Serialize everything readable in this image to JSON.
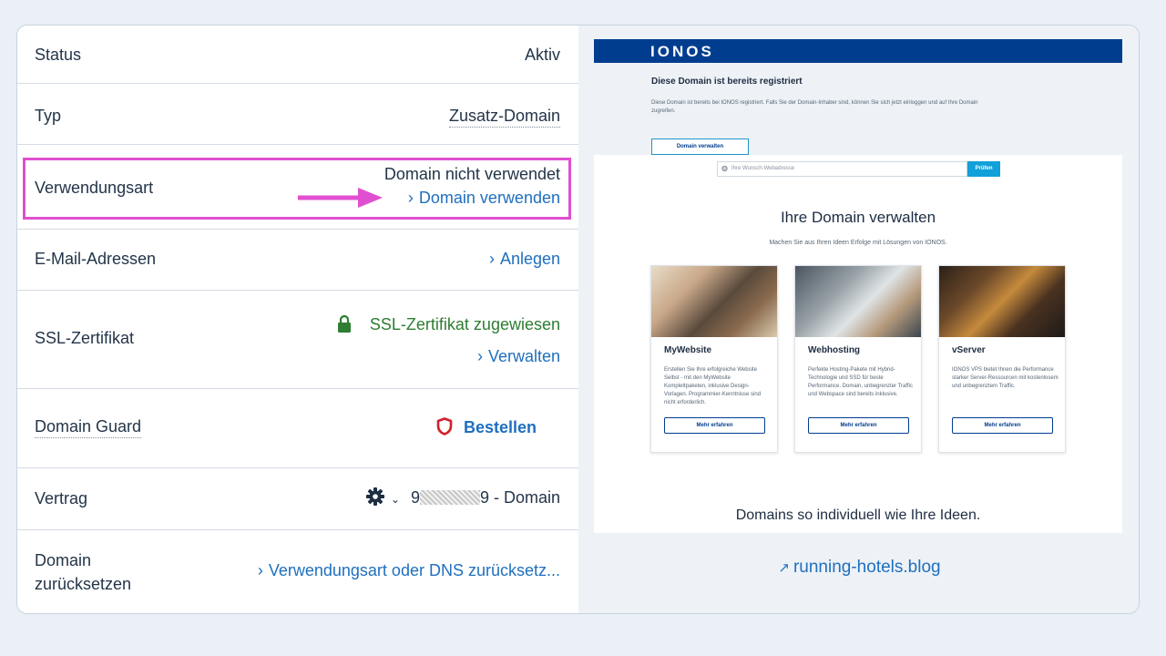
{
  "left": {
    "rows": [
      {
        "label": "Status",
        "value": "Aktiv"
      },
      {
        "label": "Typ",
        "value": "Zusatz-Domain"
      },
      {
        "label": "Verwendungsart",
        "value": "Domain nicht verwendet",
        "link": "Domain verwenden"
      },
      {
        "label": "E-Mail-Adressen",
        "link": "Anlegen"
      },
      {
        "label": "SSL-Zertifikat",
        "value": "SSL-Zertifikat zugewiesen",
        "link": "Verwalten"
      },
      {
        "label": "Domain Guard",
        "link": "Bestellen"
      },
      {
        "label": "Vertrag",
        "value_prefix": "9",
        "value_suffix": "9 - Domain"
      },
      {
        "label_line1": "Domain",
        "label_line2": "zurücksetzen",
        "link": "Verwendungsart oder DNS zurücksetz..."
      }
    ]
  },
  "preview": {
    "logo": "IONOS",
    "registered_title": "Diese Domain ist bereits registriert",
    "registered_text": "Diese Domain ist bereits bei IONOS registriert. Falls Sie der Domain-Inhaber sind, können Sie sich jetzt einloggen und auf Ihre Domain zugreifen.",
    "manage_button": "Domain verwalten",
    "search_placeholder": "Ihre Wunsch-Webadresse",
    "search_button": "Prüfen",
    "heading": "Ihre Domain verwalten",
    "subheading": "Machen Sie aus Ihren Ideen Erfolge mit Lösungen von IONOS.",
    "cards": [
      {
        "title": "MyWebsite",
        "desc": "Erstellen Sie Ihre erfolgreiche Website Selbst - mit den MyWebsite Komplettpaketen, inklusive Design-Vorlagen. Programmier-Kenntnisse sind nicht erforderlich.",
        "button": "Mehr erfahren"
      },
      {
        "title": "Webhosting",
        "desc": "Perfekte Hosting-Pakete mit Hybrid-Technologie und SSD für beste Performance. Domain, unbegrenzter Traffic und Webspace sind bereits inklusive.",
        "button": "Mehr erfahren"
      },
      {
        "title": "vServer",
        "desc": "IONOS VPS bietet Ihnen die Performance starker Server-Ressourcen mit kostenlosem und unbegrenztem Traffic.",
        "button": "Mehr erfahren"
      }
    ],
    "footer_heading": "Domains so individuell wie Ihre Ideen."
  },
  "domain_link": "running-hotels.blog",
  "colors": {
    "accent": "#1f6fbf",
    "highlight": "#e04fd0",
    "ionos_blue": "#003d8f",
    "ssl_green": "#2e7d32",
    "guard_red": "#d0202a"
  }
}
